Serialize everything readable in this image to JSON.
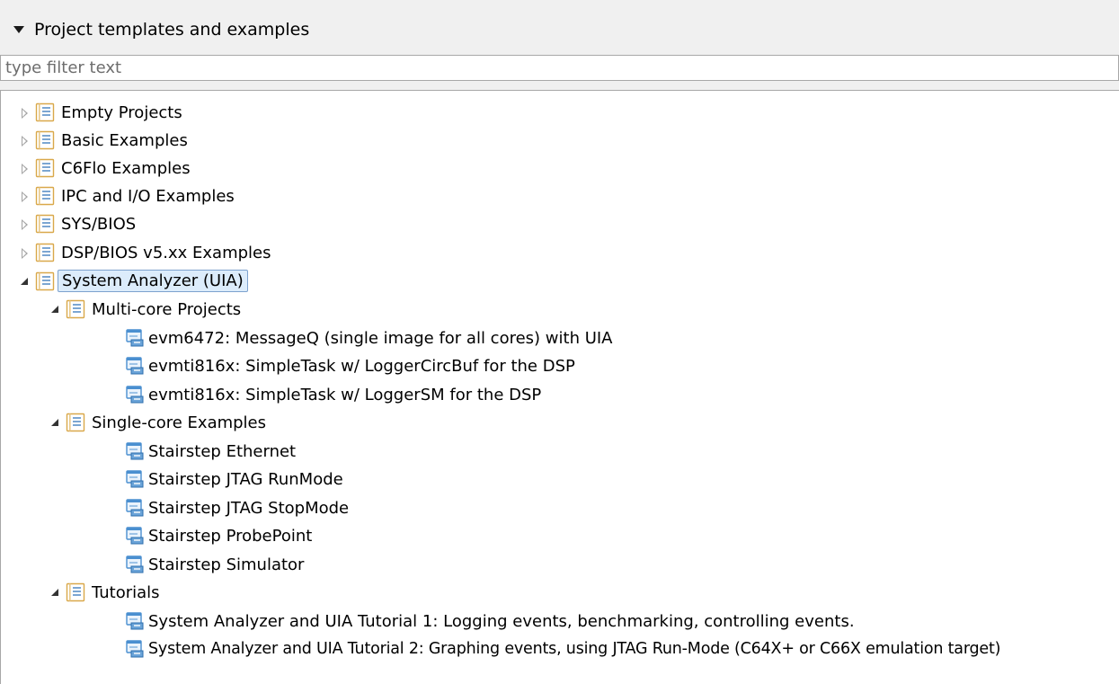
{
  "section": {
    "title": "Project templates and examples",
    "toggle_icon": "triangle-down-icon"
  },
  "filter": {
    "placeholder": "type filter text",
    "value": ""
  },
  "tree": {
    "empty_projects": "Empty Projects",
    "basic_examples": "Basic Examples",
    "c6flo_examples": "C6Flo Examples",
    "ipc_io_examples": "IPC and I/O Examples",
    "sysbios": "SYS/BIOS",
    "dspbios_examples": "DSP/BIOS v5.xx Examples",
    "system_analyzer": "System Analyzer (UIA)",
    "multicore_projects": "Multi-core Projects",
    "evm6472_messageq": "evm6472: MessageQ (single image for all cores) with UIA",
    "evmti816x_circbuf": "evmti816x: SimpleTask w/ LoggerCircBuf for the DSP",
    "evmti816x_sm": "evmti816x: SimpleTask w/ LoggerSM for the DSP",
    "singlecore_examples": "Single-core Examples",
    "stairstep_ethernet": "Stairstep Ethernet",
    "stairstep_jtag_run": "Stairstep JTAG RunMode",
    "stairstep_jtag_stop": "Stairstep JTAG StopMode",
    "stairstep_probepoint": "Stairstep ProbePoint",
    "stairstep_simulator": "Stairstep Simulator",
    "tutorials": "Tutorials",
    "tutorial1": "System Analyzer and UIA Tutorial 1: Logging events, benchmarking, controlling events.",
    "tutorial2": "System Analyzer and UIA Tutorial 2: Graphing events, using JTAG Run-Mode (C64X+ or C66X emulation target)"
  },
  "colors": {
    "selection_bg": "#dcecfb",
    "selection_border": "#7da2ce",
    "folder_frame": "#d9a84a",
    "folder_lines": "#5b8fc7",
    "project_icon": "#4a8fd0"
  }
}
